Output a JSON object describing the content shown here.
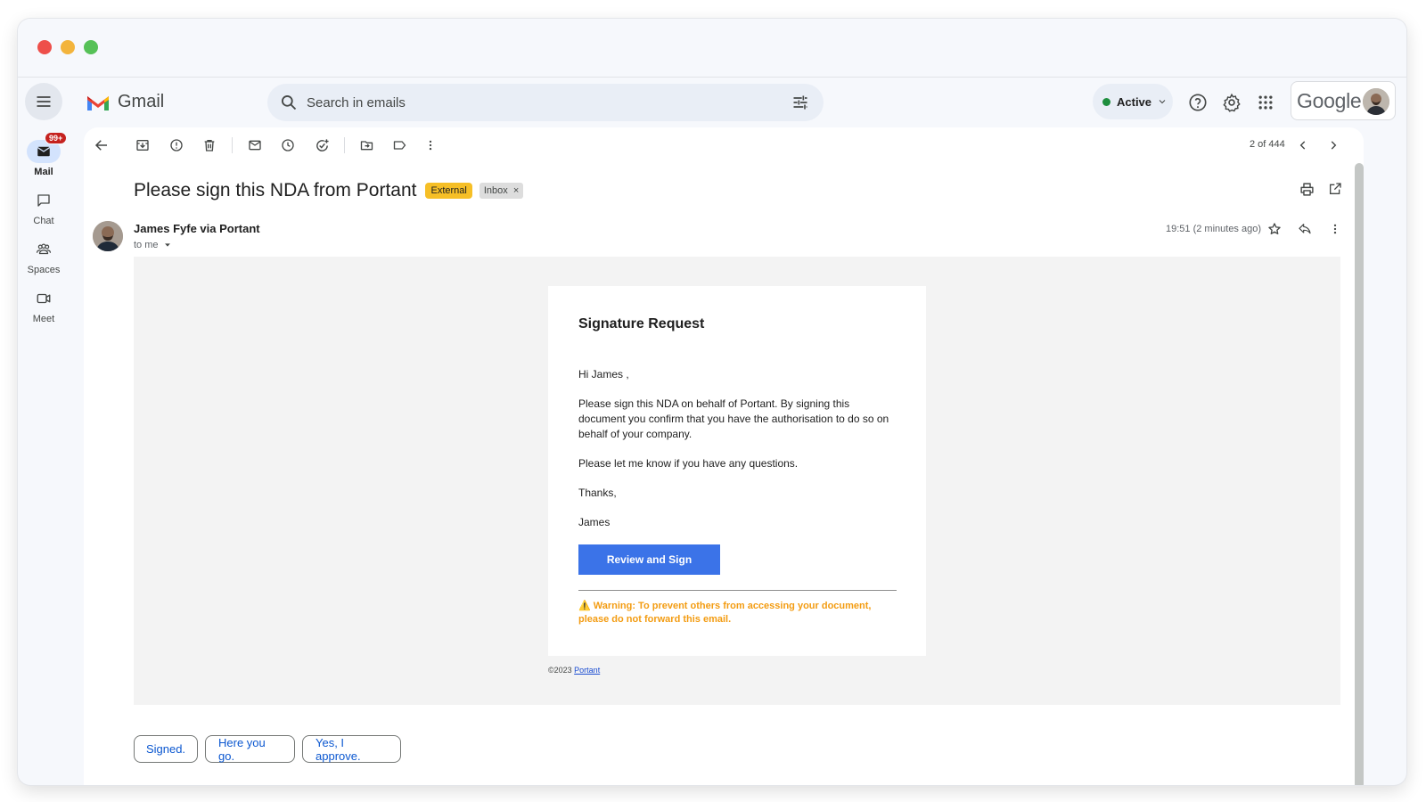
{
  "app": {
    "name": "Gmail",
    "brand_color": "#ea4335",
    "accent_color": "#0b57d0"
  },
  "header": {
    "search_placeholder": "Search in emails",
    "status_label": "Active",
    "status_color": "#1e8e3e",
    "google_label": "Google",
    "icons": [
      "menu-icon",
      "search-icon",
      "tune-icon",
      "help-icon",
      "gear-icon",
      "apps-icon"
    ]
  },
  "rail": {
    "items": [
      {
        "label": "Mail",
        "icon": "mail-icon",
        "badge": "99+",
        "active": true
      },
      {
        "label": "Chat",
        "icon": "chat-icon"
      },
      {
        "label": "Spaces",
        "icon": "spaces-icon"
      },
      {
        "label": "Meet",
        "icon": "video-icon"
      }
    ]
  },
  "toolbar": {
    "icons": [
      "back-arrow-icon",
      "archive-icon",
      "report-spam-icon",
      "delete-icon",
      "mark-unread-icon",
      "snooze-icon",
      "add-task-icon",
      "move-to-icon",
      "label-icon",
      "more-vert-icon"
    ],
    "pager": "2 of 444"
  },
  "email": {
    "subject": "Please sign this NDA from Portant",
    "labels": {
      "external": "External",
      "inbox": "Inbox",
      "inbox_remove": "×"
    },
    "sender": "James Fyfe via Portant",
    "to": "to me",
    "timestamp": "19:51 (2 minutes ago)",
    "body": {
      "heading": "Signature Request",
      "greeting": "Hi James ,",
      "paragraph1": "Please sign this NDA on behalf of Portant. By signing this document you confirm that you have the authorisation to do so on behalf of your company.",
      "paragraph2": "Please let me know if you have any questions.",
      "thanks": "Thanks,",
      "signoff": "James",
      "cta_label": "Review and Sign",
      "cta_color": "#3b73e8",
      "warning": "⚠️ Warning: To prevent others from accessing your document, please do not forward this email.",
      "warning_color": "#f39c12",
      "copyright": "©2023",
      "copyright_link": "Portant"
    }
  },
  "smart_replies": [
    "Signed.",
    "Here you go.",
    "Yes, I approve."
  ]
}
